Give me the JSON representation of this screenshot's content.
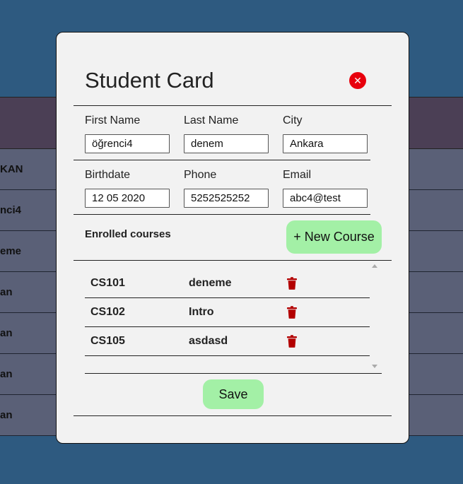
{
  "background": {
    "rows": [
      "KAN",
      "nci4",
      "eme",
      "an",
      "an",
      "an",
      "an"
    ]
  },
  "modal": {
    "title": "Student Card",
    "close_icon": "close-icon",
    "fields": {
      "first_name": {
        "label": "First Name",
        "value": "öğrenci4"
      },
      "last_name": {
        "label": "Last Name",
        "value": "denem"
      },
      "city": {
        "label": "City",
        "value": "Ankara"
      },
      "birthdate": {
        "label": "Birthdate",
        "value": "12 05 2020"
      },
      "phone": {
        "label": "Phone",
        "value": "5252525252"
      },
      "email": {
        "label": "Email",
        "value": "abc4@test"
      }
    },
    "enrolled_label": "Enrolled courses",
    "new_course_label": "+ New Course",
    "courses": [
      {
        "code": "CS101",
        "name": "deneme"
      },
      {
        "code": "CS102",
        "name": "Intro"
      },
      {
        "code": "CS105",
        "name": "asdasd"
      }
    ],
    "save_label": "Save"
  },
  "colors": {
    "page_bg": "#2e5a80",
    "modal_bg": "#f2f2f2",
    "accent_green": "#a3f0a6",
    "close_red": "#e8000d",
    "trash_red": "#b30000"
  }
}
